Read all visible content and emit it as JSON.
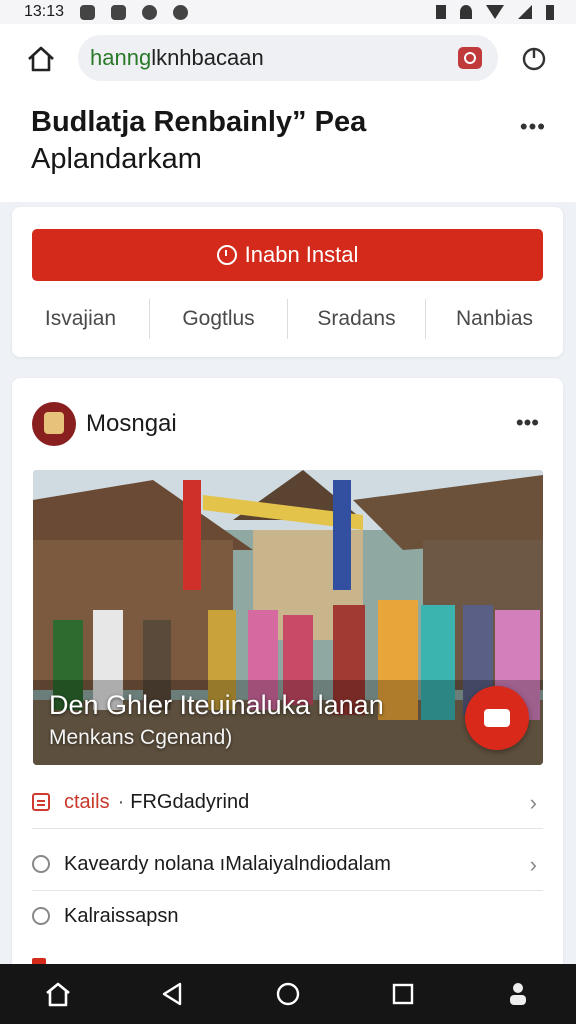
{
  "status_bar": {
    "time": "13:13"
  },
  "browser": {
    "url_highlight": "hanng",
    "url_rest": "lknhbacaan"
  },
  "page": {
    "title_line1": "Budlatja Renbainly” Pea",
    "title_line2": "Aplandarkam",
    "more_label": "•••"
  },
  "install_card": {
    "install_label": "Inabn Instal",
    "tabs": [
      "Isvajian",
      "Gogtlus",
      "Sradans",
      "Nanbias"
    ]
  },
  "post": {
    "author": "Mosngai",
    "more_label": "•••",
    "caption_title": "Den Ghler Iteuinaluka lanan",
    "caption_sub": "Menkans Cgenand)",
    "rows": [
      {
        "label": "ctails",
        "text": "FRGdadyrind"
      },
      {
        "text": "Kaveardy nolana ıMalaiyalndiodalam"
      },
      {
        "text": "Kalraissapsn"
      }
    ]
  },
  "colors": {
    "accent": "#d42a1b",
    "tabs_text": "#4a4a4a"
  },
  "icons": [
    "home-icon",
    "camera-icon",
    "power-icon",
    "clock-icon",
    "more-icon",
    "document-icon",
    "chevron-right-icon",
    "back-icon",
    "circle-home-icon",
    "square-recents-icon",
    "assistant-icon"
  ]
}
